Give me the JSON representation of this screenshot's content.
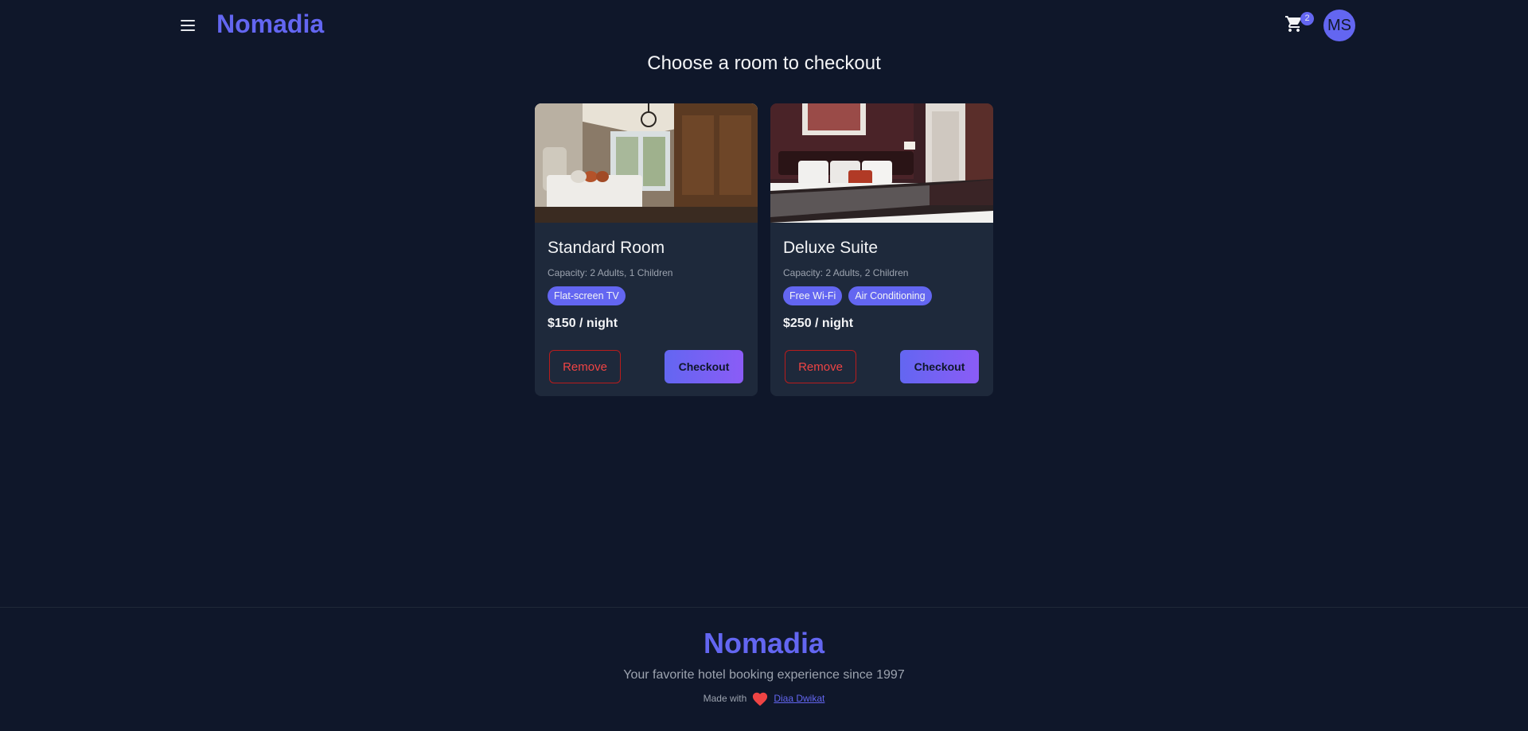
{
  "header": {
    "brand": "Nomadia",
    "cart_count": "2",
    "avatar_initials": "MS"
  },
  "main": {
    "title": "Choose a room to checkout",
    "rooms": [
      {
        "name": "Standard Room",
        "capacity": "Capacity: 2 Adults, 1 Children",
        "amenities": [
          "Flat-screen TV"
        ],
        "price": "$150 / night",
        "remove_label": "Remove",
        "checkout_label": "Checkout"
      },
      {
        "name": "Deluxe Suite",
        "capacity": "Capacity: 2 Adults, 2 Children",
        "amenities": [
          "Free Wi-Fi",
          "Air Conditioning"
        ],
        "price": "$250 / night",
        "remove_label": "Remove",
        "checkout_label": "Checkout"
      }
    ]
  },
  "footer": {
    "brand": "Nomadia",
    "tagline": "Your favorite hotel booking experience since 1997",
    "made_with": "Made with",
    "author": "Diaa Dwikat"
  },
  "colors": {
    "background": "#0f172a",
    "card": "#1e293b",
    "accent": "#6366f1",
    "danger": "#ef4444"
  }
}
